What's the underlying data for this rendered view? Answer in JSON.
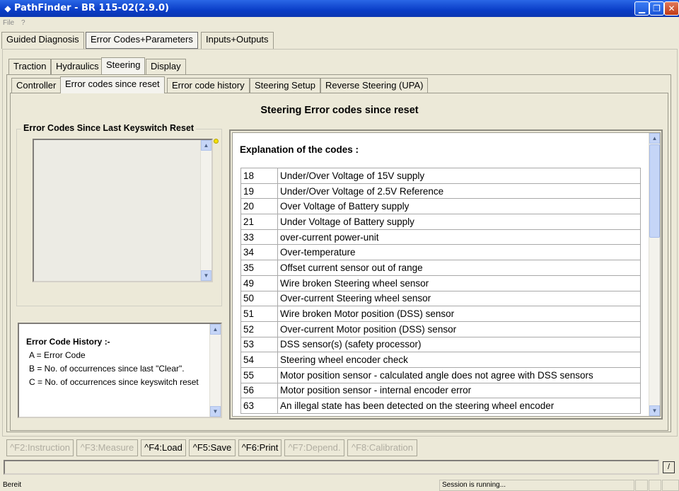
{
  "window": {
    "title": "PathFinder - BR 115-02(2.9.0)",
    "icon": "diamond-icon"
  },
  "menubar": {
    "items": [
      "File",
      "?"
    ]
  },
  "main_tabs": [
    "Guided Diagnosis",
    "Error Codes+Parameters",
    "Inputs+Outputs"
  ],
  "sub_tabs": [
    "Traction",
    "Hydraulics",
    "Steering",
    "Display"
  ],
  "steering_tabs": [
    "Controller",
    "Error codes since reset",
    "Error code history",
    "Steering Setup",
    "Reverse Steering (UPA)"
  ],
  "page_title": "Steering Error codes since reset",
  "keyswitch_group": {
    "title": "Error Codes Since Last Keyswitch Reset"
  },
  "history_box": {
    "title": "Error Code History :-",
    "line_a": "A = Error Code",
    "line_b": "B = No. of occurrences since last \"Clear\".",
    "line_c": "C = No. of occurrences since keyswitch reset"
  },
  "explanation": {
    "heading": "Explanation of the codes :",
    "codes": [
      {
        "code": "18",
        "text": "Under/Over Voltage of 15V supply"
      },
      {
        "code": "19",
        "text": "Under/Over Voltage of 2.5V Reference"
      },
      {
        "code": "20",
        "text": "Over Voltage of Battery supply"
      },
      {
        "code": "21",
        "text": "Under Voltage of Battery supply"
      },
      {
        "code": "33",
        "text": "over-current power-unit"
      },
      {
        "code": "34",
        "text": "Over-temperature"
      },
      {
        "code": "35",
        "text": "Offset current sensor out of range"
      },
      {
        "code": "49",
        "text": "Wire broken Steering wheel sensor"
      },
      {
        "code": "50",
        "text": "Over-current Steering wheel sensor"
      },
      {
        "code": "51",
        "text": "Wire broken Motor position (DSS) sensor"
      },
      {
        "code": "52",
        "text": "Over-current Motor position (DSS) sensor"
      },
      {
        "code": "53",
        "text": "DSS sensor(s) (safety processor)"
      },
      {
        "code": "54",
        "text": "Steering wheel encoder check"
      },
      {
        "code": "55",
        "text": "Motor position sensor - calculated angle does not agree with DSS sensors"
      },
      {
        "code": "56",
        "text": "Motor position sensor - internal encoder error"
      },
      {
        "code": "63",
        "text": "An illegal state has been detected on the steering wheel encoder"
      }
    ]
  },
  "function_keys": [
    {
      "label": "^F2:Instruction",
      "enabled": false
    },
    {
      "label": "^F3:Measure",
      "enabled": false
    },
    {
      "label": "^F4:Load",
      "enabled": true
    },
    {
      "label": "^F5:Save",
      "enabled": true
    },
    {
      "label": "^F6:Print",
      "enabled": true
    },
    {
      "label": "^F7:Depend.",
      "enabled": false
    },
    {
      "label": "^F8:Calibration",
      "enabled": false
    }
  ],
  "statusbar": {
    "left": "Bereit",
    "session": "Session is running..."
  },
  "colors": {
    "titlebar": "#0a3dc7",
    "window_bg": "#ece9d8",
    "indicator": "#f3e000"
  }
}
